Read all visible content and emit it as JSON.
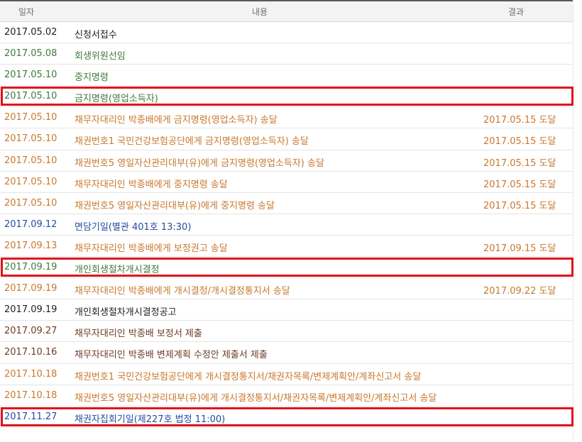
{
  "table": {
    "headers": {
      "date": "일자",
      "content": "내용",
      "result": "결과"
    },
    "rows": [
      {
        "date": "2017.05.02",
        "content": "신청서접수",
        "result": "",
        "color": "black"
      },
      {
        "date": "2017.05.08",
        "content": "회생위원선임",
        "result": "",
        "color": "green"
      },
      {
        "date": "2017.05.10",
        "content": "중지명령",
        "result": "",
        "color": "green"
      },
      {
        "date": "2017.05.10",
        "content": "금지명령(영업소득자)",
        "result": "",
        "color": "green"
      },
      {
        "date": "2017.05.10",
        "content": "채무자대리인 박종배에게 금지명령(영업소득자) 송달",
        "result": "2017.05.15 도달",
        "color": "orange"
      },
      {
        "date": "2017.05.10",
        "content": "채권번호1 국민건강보험공단에게 금지명령(영업소득자) 송달",
        "result": "2017.05.15 도달",
        "color": "orange"
      },
      {
        "date": "2017.05.10",
        "content": "채권번호5 영일자산관리대부(유)에게 금지명령(영업소득자) 송달",
        "result": "2017.05.15 도달",
        "color": "orange"
      },
      {
        "date": "2017.05.10",
        "content": "채무자대리인 박종배에게 중지명령 송달",
        "result": "2017.05.15 도달",
        "color": "orange"
      },
      {
        "date": "2017.05.10",
        "content": "채권번호5 영일자산관리대부(유)에게 중지명령 송달",
        "result": "2017.05.15 도달",
        "color": "orange"
      },
      {
        "date": "2017.09.12",
        "content": "면담기일(별관 401호 13:30)",
        "result": "",
        "color": "blue"
      },
      {
        "date": "2017.09.13",
        "content": "채무자대리인 박종배에게 보정권고 송달",
        "result": "2017.09.15 도달",
        "color": "orange"
      },
      {
        "date": "2017.09.19",
        "content": "개인회생절차개시결정",
        "result": "",
        "color": "green"
      },
      {
        "date": "2017.09.19",
        "content": "채무자대리인 박종배에게 개시결정/개시결정통지서 송달",
        "result": "2017.09.22 도달",
        "color": "orange"
      },
      {
        "date": "2017.09.19",
        "content": "개인회생절차개시결정공고",
        "result": "",
        "color": "black"
      },
      {
        "date": "2017.09.27",
        "content": "채무자대리인 박종배 보정서 제출",
        "result": "",
        "color": "brown"
      },
      {
        "date": "2017.10.16",
        "content": "채무자대리인 박종배 변제계획 수정안 제출서 제출",
        "result": "",
        "color": "brown"
      },
      {
        "date": "2017.10.18",
        "content": "채권번호1 국민건강보험공단에게 개시결정통지서/채권자목록/변제계획안/계좌신고서 송달",
        "result": "",
        "color": "orange"
      },
      {
        "date": "2017.10.18",
        "content": "채권번호5 영일자산관리대부(유)에게 개시결정통지서/채권자목록/변제계획안/계좌신고서 송달",
        "result": "",
        "color": "orange"
      },
      {
        "date": "2017.11.27",
        "content": "채권자집회기일(제227호 법정 11:00)",
        "result": "",
        "color": "blue"
      }
    ]
  },
  "highlight_color": "#e0111b",
  "highlighted_rows": [
    3,
    11,
    18
  ]
}
